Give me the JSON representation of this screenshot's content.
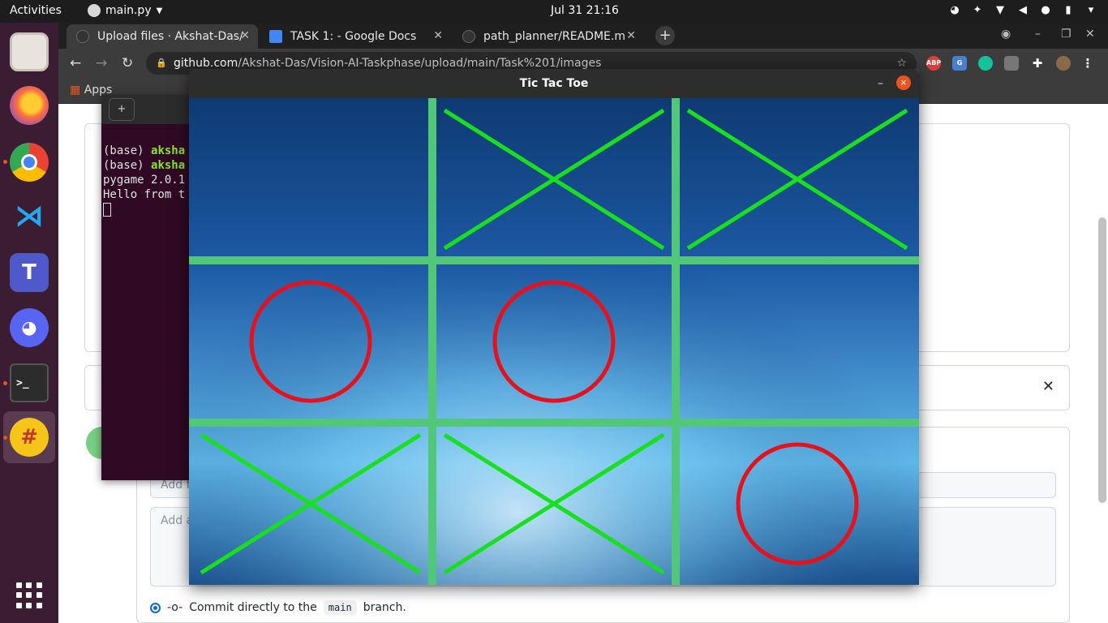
{
  "topbar": {
    "activities": "Activities",
    "app_name": "main.py",
    "clock": "Jul 31  21:16",
    "tray_icons": [
      "discord-icon",
      "teams-icon",
      "wifi-icon",
      "volume-icon",
      "microphone-icon",
      "battery-icon",
      "power-menu-icon"
    ]
  },
  "dock": {
    "items": [
      "files",
      "firefox",
      "chrome",
      "vscode",
      "teams",
      "discord",
      "terminal",
      "tictactoe"
    ],
    "running": [
      "chrome",
      "terminal",
      "tictactoe"
    ],
    "active": "tictactoe",
    "app_grid_icon": "show-applications-icon"
  },
  "browser": {
    "tabs": [
      {
        "title": "Upload files · Akshat-Das/",
        "active": true
      },
      {
        "title": "TASK 1: - Google Docs",
        "active": false
      },
      {
        "title": "path_planner/README.m",
        "active": false
      }
    ],
    "url_host": "github.com",
    "url_path": "/Akshat-Das/Vision-AI-Taskphase/upload/main/Task%201/images",
    "bookmarks_label": "Apps",
    "extensions": [
      "ABP",
      "G"
    ],
    "page": {
      "commit_summary_placeholder": "Add file",
      "commit_description_placeholder": "Add a",
      "commit_option_text": "Commit directly to the",
      "branch": "main",
      "commit_option_suffix": "branch."
    }
  },
  "terminal": {
    "lines": [
      {
        "prefix": "(base) ",
        "user": "aksha"
      },
      {
        "prefix": "(base) ",
        "user": "aksha"
      },
      {
        "prefix": "pygame 2.0.1",
        "user": ""
      },
      {
        "prefix": "Hello from t",
        "user": ""
      }
    ]
  },
  "game": {
    "window_title": "Tic Tac Toe",
    "minimize_label": "–",
    "close_label": "×",
    "board": [
      [
        "",
        "X",
        "X"
      ],
      [
        "O",
        "O",
        ""
      ],
      [
        "X",
        "X",
        "O"
      ]
    ],
    "colors": {
      "x": "#18e01c",
      "o": "#e8101a",
      "grid": "#52c77a",
      "background_top": "#0e3a72",
      "background_bottom": "#6ec6f0"
    }
  }
}
